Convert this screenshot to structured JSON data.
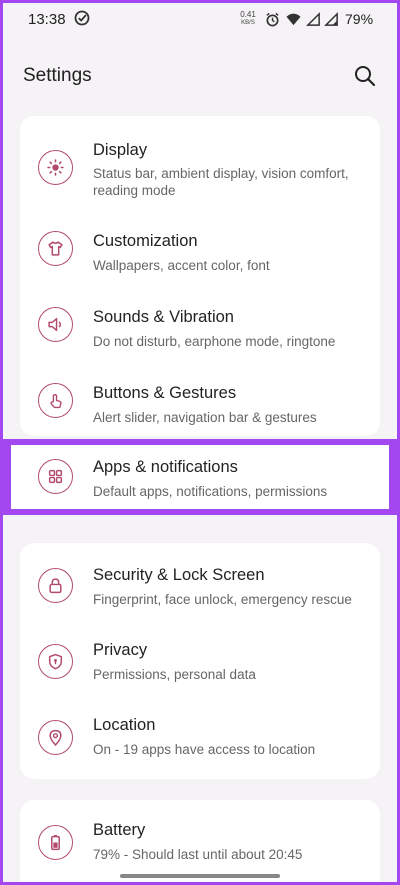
{
  "status_bar": {
    "time": "13:38",
    "speed_value": "0.41",
    "speed_unit": "KB/S",
    "battery": "79%"
  },
  "header": {
    "title": "Settings"
  },
  "colors": {
    "accent": "#b24a6f",
    "highlight": "#a348f0"
  },
  "settings": [
    {
      "title": "Display",
      "subtitle": "Status bar, ambient display, vision comfort, reading mode",
      "icon": "sun-icon"
    },
    {
      "title": "Customization",
      "subtitle": "Wallpapers, accent color, font",
      "icon": "tshirt-icon"
    },
    {
      "title": "Sounds & Vibration",
      "subtitle": "Do not disturb, earphone mode, ringtone",
      "icon": "speaker-icon"
    },
    {
      "title": "Buttons & Gestures",
      "subtitle": "Alert slider, navigation bar & gestures",
      "icon": "gesture-icon"
    },
    {
      "title": "Apps & notifications",
      "subtitle": "Default apps, notifications, permissions",
      "icon": "apps-grid-icon"
    },
    {
      "title": "Security & Lock Screen",
      "subtitle": "Fingerprint, face unlock, emergency rescue",
      "icon": "lock-icon"
    },
    {
      "title": "Privacy",
      "subtitle": "Permissions, personal data",
      "icon": "shield-icon"
    },
    {
      "title": "Location",
      "subtitle": "On - 19 apps have access to location",
      "icon": "location-pin-icon"
    },
    {
      "title": "Battery",
      "subtitle": "79% - Should last until about 20:45",
      "icon": "battery-icon"
    }
  ]
}
